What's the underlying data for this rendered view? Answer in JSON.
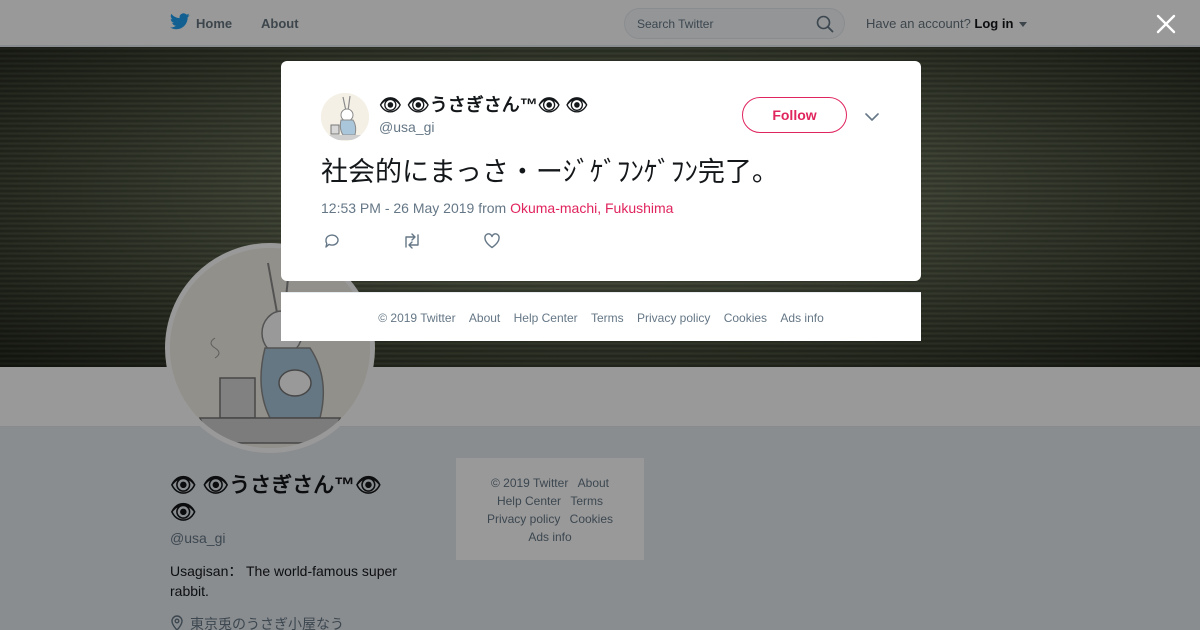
{
  "topbar": {
    "home_label": "Home",
    "about_label": "About",
    "search_placeholder": "Search Twitter",
    "account_prompt": "Have an account?",
    "login_label": "Log in"
  },
  "profile": {
    "name": "👁 👁うさぎさん™👁 👁",
    "handle": "@usa_gi",
    "bio": "Usagisan： The world-famous super rabbit.",
    "location": "東京兎のうさぎ小屋なう"
  },
  "side_footer": {
    "links": [
      "© 2019 Twitter",
      "About",
      "Help Center",
      "Terms",
      "Privacy policy",
      "Cookies",
      "Ads info"
    ]
  },
  "tweet": {
    "name": "👁 👁うさぎさん™👁 👁",
    "handle": "@usa_gi",
    "follow_label": "Follow",
    "text": "社会的にまっさ・ーｼﾞｹﾞﾌﾝｹﾞﾌﾝ完了。",
    "time": "12:53 PM - 26 May 2019",
    "from_label": "from",
    "place": "Okuma-machi, Fukushima"
  },
  "modal_footer": {
    "links": [
      "© 2019 Twitter",
      "About",
      "Help Center",
      "Terms",
      "Privacy policy",
      "Cookies",
      "Ads info"
    ]
  },
  "colors": {
    "accent": "#e0245e",
    "twitter_blue": "#1da1f2",
    "muted": "#657786"
  },
  "icons": [
    "twitter-bird-icon",
    "search-icon",
    "caret-down-icon",
    "close-icon",
    "chevron-down-icon",
    "reply-icon",
    "retweet-icon",
    "like-icon",
    "location-pin-icon"
  ]
}
